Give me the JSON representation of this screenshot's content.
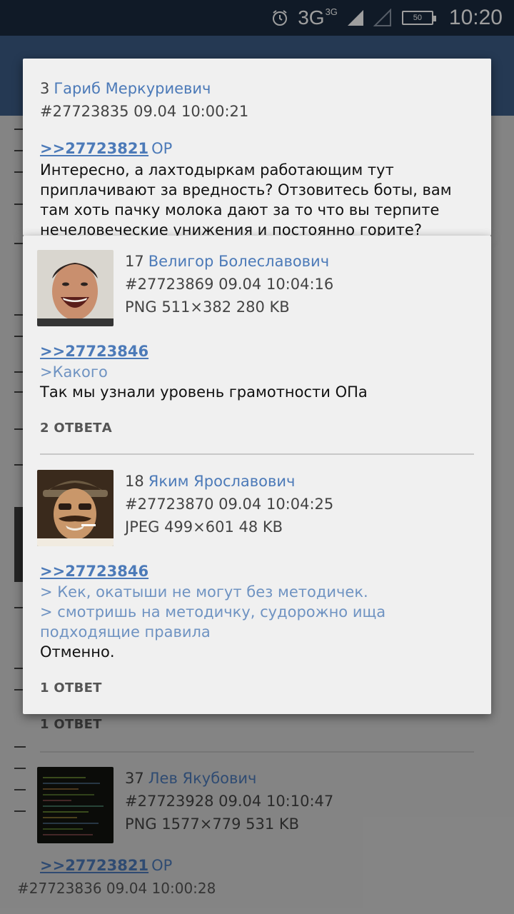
{
  "status_bar": {
    "network": "3G",
    "network_sup": "3G",
    "battery": "50",
    "time": "10:20"
  },
  "background": {
    "replies_label": "1 ОТВЕТ",
    "post": {
      "number": "37",
      "name": "Лев Якубович",
      "id_date": "#27723928 09.04 10:10:47",
      "file": "PNG 1577×779 531 KB",
      "reflink": ">>27723821",
      "op": "OP"
    },
    "bottom_partial": "#27723836 09.04 10:00:28"
  },
  "popup1": {
    "number": "3",
    "name": "Гариб Меркуриевич",
    "id_date": "#27723835 09.04 10:00:21",
    "reflink": ">>27723821",
    "op": "OP",
    "text": "Интересно, а лахтодыркам работающим тут приплачивают за вредность? Отзовитесь боты, вам там хоть пачку молока дают за то что вы терпите нечеловеческие унижения и постоянно горите?"
  },
  "popup2": {
    "posts": [
      {
        "number": "17",
        "name": "Велигор Болеславович",
        "id_date": "#27723869 09.04 10:04:16",
        "file": "PNG 511×382 280 KB",
        "reflink": ">>27723846",
        "quotes": [
          ">Какого"
        ],
        "text": "Так мы узнали уровень грамотности ОПа",
        "replies": "2 ОТВЕТА"
      },
      {
        "number": "18",
        "name": "Яким Ярославович",
        "id_date": "#27723870 09.04 10:04:25",
        "file": "JPEG 499×601 48 KB",
        "reflink": ">>27723846",
        "quotes": [
          "> Кек, окатыши не могут без методичек.",
          "> смотришь на методичку, судорожно ища подходящие правила"
        ],
        "text": "Отменно.",
        "replies": "1 ОТВЕТ"
      }
    ]
  }
}
